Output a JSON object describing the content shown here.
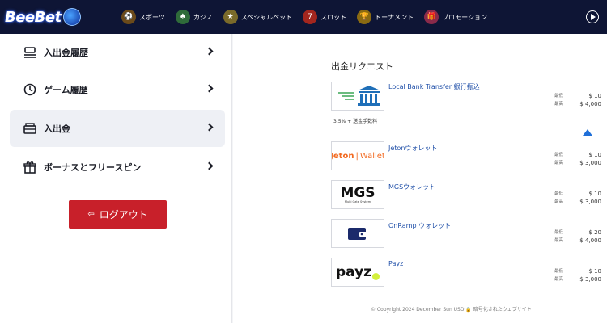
{
  "header": {
    "logo_text": "BeeBet",
    "nav": [
      {
        "label": "スポーツ",
        "icon": "sports-icon"
      },
      {
        "label": "カジノ",
        "icon": "casino-icon"
      },
      {
        "label": "スペシャルベット",
        "icon": "special-bet-icon"
      },
      {
        "label": "スロット",
        "icon": "slot-icon"
      },
      {
        "label": "トーナメント",
        "icon": "tournament-icon"
      },
      {
        "label": "プロモーション",
        "icon": "promotion-icon"
      }
    ]
  },
  "sidebar": {
    "items": [
      {
        "label": "入出金履歴",
        "icon": "transaction-history-icon",
        "active": false
      },
      {
        "label": "ゲーム履歴",
        "icon": "clock-icon",
        "active": false
      },
      {
        "label": "入出金",
        "icon": "cashier-icon",
        "active": true
      },
      {
        "label": "ボーナスとフリースピン",
        "icon": "gift-icon",
        "active": false
      }
    ],
    "logout_label": "ログアウト"
  },
  "main": {
    "section_title": "出金リクエスト",
    "methods": [
      {
        "name": "Local Bank Transfer 銀行振込",
        "logo": "bank-logo",
        "fee": "3.5% + 送金手数料",
        "min_label": "最低",
        "min": "$ 10",
        "max_label": "最高",
        "max": "$ 4,000"
      },
      {
        "name": "Jetonウォレット",
        "logo": "jeton-logo",
        "logo_text": "Jeton",
        "logo_text2": "Wallet",
        "min_label": "最低",
        "min": "$ 10",
        "max_label": "最高",
        "max": "$ 3,000"
      },
      {
        "name": "MGSウォレット",
        "logo": "mgs-logo",
        "logo_text": "MGS",
        "logo_sub": "Multi Gate System",
        "min_label": "最低",
        "min": "$ 10",
        "max_label": "最高",
        "max": "$ 3,000"
      },
      {
        "name": "OnRamp ウォレット",
        "logo": "onramp-logo",
        "min_label": "最低",
        "min": "$ 20",
        "max_label": "最高",
        "max": "$ 4,000"
      },
      {
        "name": "Payz",
        "logo": "payz-logo",
        "logo_text": "payz",
        "min_label": "最低",
        "min": "$ 10",
        "max_label": "最高",
        "max": "$ 3,000"
      }
    ],
    "footer": "© Copyright 2024 December Sun USD  🔒 暗号化されたウェブサイト"
  },
  "colors": {
    "header_bg": "#0e1535",
    "logout_bg": "#c8202a",
    "link": "#1f4fa8",
    "accent": "#1f6fd8"
  }
}
